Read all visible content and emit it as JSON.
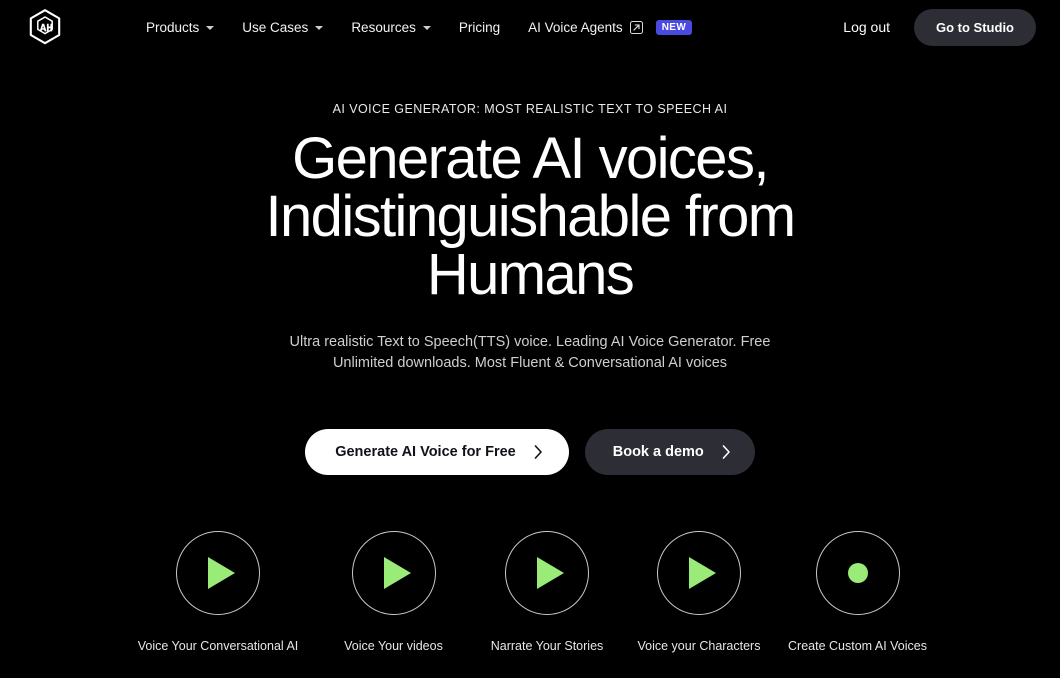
{
  "brand": {
    "logo_icon": "playht-hexagon-logo"
  },
  "header": {
    "nav": [
      {
        "label": "Products",
        "has_caret": true
      },
      {
        "label": "Use Cases",
        "has_caret": true
      },
      {
        "label": "Resources",
        "has_caret": true
      },
      {
        "label": "Pricing",
        "has_caret": false
      },
      {
        "label": "AI Voice Agents",
        "has_caret": false,
        "external": true,
        "badge": "NEW"
      }
    ],
    "logout_label": "Log out",
    "studio_label": "Go to Studio",
    "badge_color": "#4b4ae0",
    "studio_bg": "#2c2d35"
  },
  "hero": {
    "eyebrow": "AI VOICE GENERATOR: MOST REALISTIC TEXT TO SPEECH AI",
    "headline": "Generate AI voices, Indistinguishable from Humans",
    "subhead": "Ultra realistic Text to Speech(TTS) voice. Leading AI Voice Generator. Free Unlimited downloads. Most Fluent & Conversational AI voices",
    "primary_cta": "Generate AI Voice for Free",
    "secondary_cta": "Book a demo"
  },
  "features": {
    "accent_color": "#9aeb78",
    "items": [
      {
        "label": "Voice Your Conversational AI",
        "icon": "play-icon"
      },
      {
        "label": "Voice Your videos",
        "icon": "play-icon"
      },
      {
        "label": "Narrate Your Stories",
        "icon": "play-icon"
      },
      {
        "label": "Voice your Characters",
        "icon": "play-icon"
      },
      {
        "label": "Create Custom AI Voices",
        "icon": "record-dot-icon"
      }
    ]
  },
  "theme": {
    "background": "#000000",
    "text": "#ffffff"
  }
}
